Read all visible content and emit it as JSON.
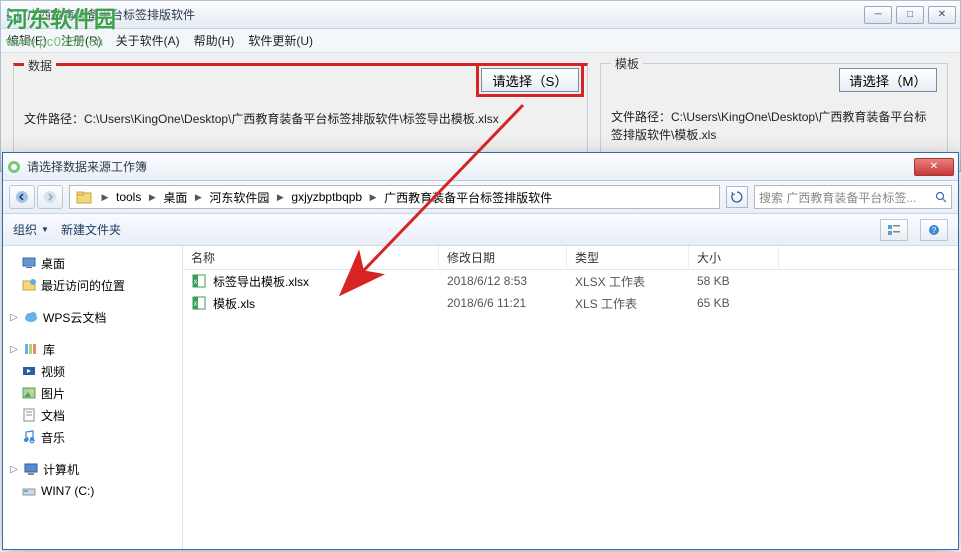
{
  "watermark": {
    "text": "河东软件园",
    "url": "www.pc0359.cn"
  },
  "main": {
    "title": "广西教育装备平台标签排版软件",
    "menu": [
      "编辑(E)",
      "注册(R)",
      "关于软件(A)",
      "帮助(H)",
      "软件更新(U)"
    ],
    "data_group": {
      "legend": "数据",
      "select_btn": "请选择（S）",
      "path_label": "文件路径：",
      "path_value": "C:\\Users\\KingOne\\Desktop\\广西教育装备平台标签排版软件\\标签导出模板.xlsx"
    },
    "tpl_group": {
      "legend": "模板",
      "select_btn": "请选择（M）",
      "path_label": "文件路径：",
      "path_value": "C:\\Users\\KingOne\\Desktop\\广西教育装备平台标签排版软件\\模板.xls"
    }
  },
  "dialog": {
    "title": "请选择数据来源工作簿",
    "breadcrumb": [
      "tools",
      "桌面",
      "河东软件园",
      "gxjyzbptbqpb",
      "广西教育装备平台标签排版软件"
    ],
    "search_placeholder": "搜索 广西教育装备平台标签...",
    "toolbar": {
      "organize": "组织",
      "newfolder": "新建文件夹"
    },
    "tree": {
      "desktop": "桌面",
      "recent": "最近访问的位置",
      "wps": "WPS云文档",
      "libraries": "库",
      "videos": "视频",
      "pictures": "图片",
      "documents": "文档",
      "music": "音乐",
      "computer": "计算机",
      "win7": "WIN7 (C:)"
    },
    "columns": {
      "name": "名称",
      "date": "修改日期",
      "type": "类型",
      "size": "大小"
    },
    "files": [
      {
        "name": "标签导出模板.xlsx",
        "date": "2018/6/12 8:53",
        "type": "XLSX 工作表",
        "size": "58 KB"
      },
      {
        "name": "模板.xls",
        "date": "2018/6/6 11:21",
        "type": "XLS 工作表",
        "size": "65 KB"
      }
    ]
  }
}
